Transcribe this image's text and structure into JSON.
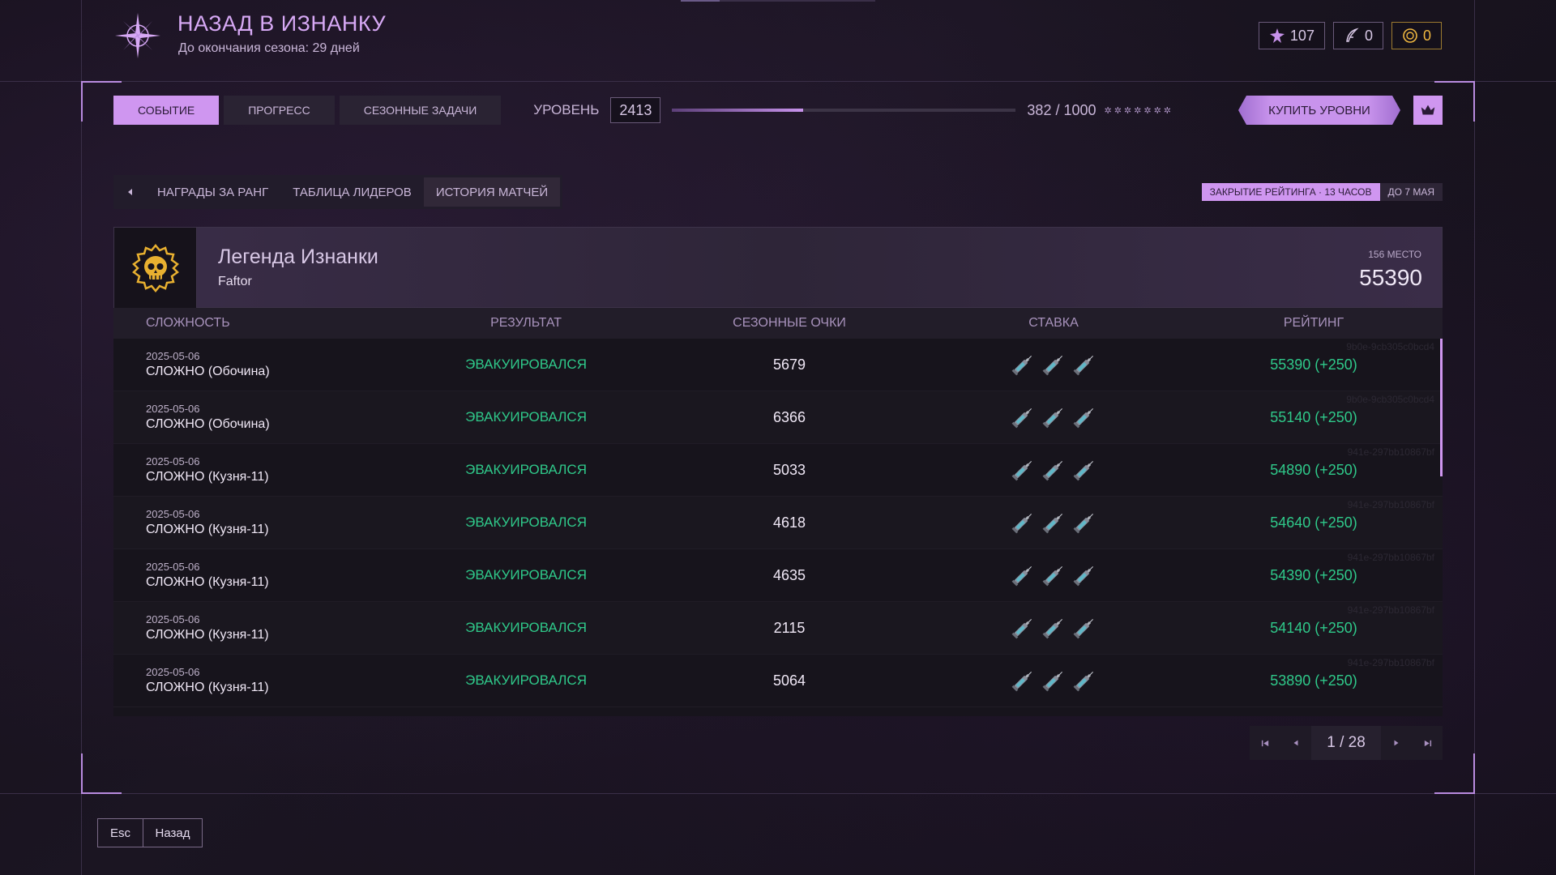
{
  "header": {
    "title": "НАЗАД В ИЗНАНКУ",
    "season_text": "До окончания сезона: 29 дней"
  },
  "currencies": {
    "shards": "107",
    "tokens": "0",
    "coins": "0"
  },
  "tabs": [
    {
      "label": "СОБЫТИЕ",
      "active": true
    },
    {
      "label": "ПРОГРЕСС",
      "active": false
    },
    {
      "label": "СЕЗОННЫЕ ЗАДАЧИ",
      "active": false
    }
  ],
  "level": {
    "label": "УРОВЕНЬ",
    "value": "2413",
    "progress_text": "382 / 1000",
    "progress_fraction": 0.382,
    "stars": "✲✲✲✲✲✲✲"
  },
  "buy_levels_label": "КУПИТЬ УРОВНИ",
  "subtabs": [
    {
      "label": "НАГРАДЫ ЗА РАНГ",
      "active": false
    },
    {
      "label": "ТАБЛИЦА ЛИДЕРОВ",
      "active": false
    },
    {
      "label": "ИСТОРИЯ МАТЧЕЙ",
      "active": true
    }
  ],
  "rating_close": {
    "main": "ЗАКРЫТИЕ РЕЙТИНГА · 13 ЧАСОВ",
    "date": "ДО 7 МАЯ"
  },
  "player": {
    "title": "Легенда Изнанки",
    "name": "Faftor",
    "place": "156 МЕСТО",
    "score": "55390"
  },
  "table": {
    "headers": [
      "СЛОЖНОСТЬ",
      "РЕЗУЛЬТАТ",
      "СЕЗОННЫЕ ОЧКИ",
      "СТАВКА",
      "РЕЙТИНГ"
    ],
    "rows": [
      {
        "date": "2025-05-06",
        "mode": "СЛОЖНО (Обочина)",
        "result": "ЭВАКУИРОВАЛСЯ",
        "points": "5679",
        "rating": "55390 (+250)",
        "hash": "9b0e-9cb305c0bcd4"
      },
      {
        "date": "2025-05-06",
        "mode": "СЛОЖНО (Обочина)",
        "result": "ЭВАКУИРОВАЛСЯ",
        "points": "6366",
        "rating": "55140 (+250)",
        "hash": "9b0e-9cb305c0bcd4"
      },
      {
        "date": "2025-05-06",
        "mode": "СЛОЖНО (Кузня-11)",
        "result": "ЭВАКУИРОВАЛСЯ",
        "points": "5033",
        "rating": "54890 (+250)",
        "hash": "941e-297bb10867bf"
      },
      {
        "date": "2025-05-06",
        "mode": "СЛОЖНО (Кузня-11)",
        "result": "ЭВАКУИРОВАЛСЯ",
        "points": "4618",
        "rating": "54640 (+250)",
        "hash": "941e-297bb10867bf"
      },
      {
        "date": "2025-05-06",
        "mode": "СЛОЖНО (Кузня-11)",
        "result": "ЭВАКУИРОВАЛСЯ",
        "points": "4635",
        "rating": "54390 (+250)",
        "hash": "941e-297bb10867bf"
      },
      {
        "date": "2025-05-06",
        "mode": "СЛОЖНО (Кузня-11)",
        "result": "ЭВАКУИРОВАЛСЯ",
        "points": "2115",
        "rating": "54140 (+250)",
        "hash": "941e-297bb10867bf"
      },
      {
        "date": "2025-05-06",
        "mode": "СЛОЖНО (Кузня-11)",
        "result": "ЭВАКУИРОВАЛСЯ",
        "points": "5064",
        "rating": "53890 (+250)",
        "hash": "941e-297bb10867bf"
      }
    ]
  },
  "pagination": {
    "text": "1 / 28"
  },
  "footer": {
    "key": "Esc",
    "label": "Назад"
  },
  "colors": {
    "accent": "#cf96f0",
    "success": "#2fc98a",
    "gold": "#f0b840"
  }
}
